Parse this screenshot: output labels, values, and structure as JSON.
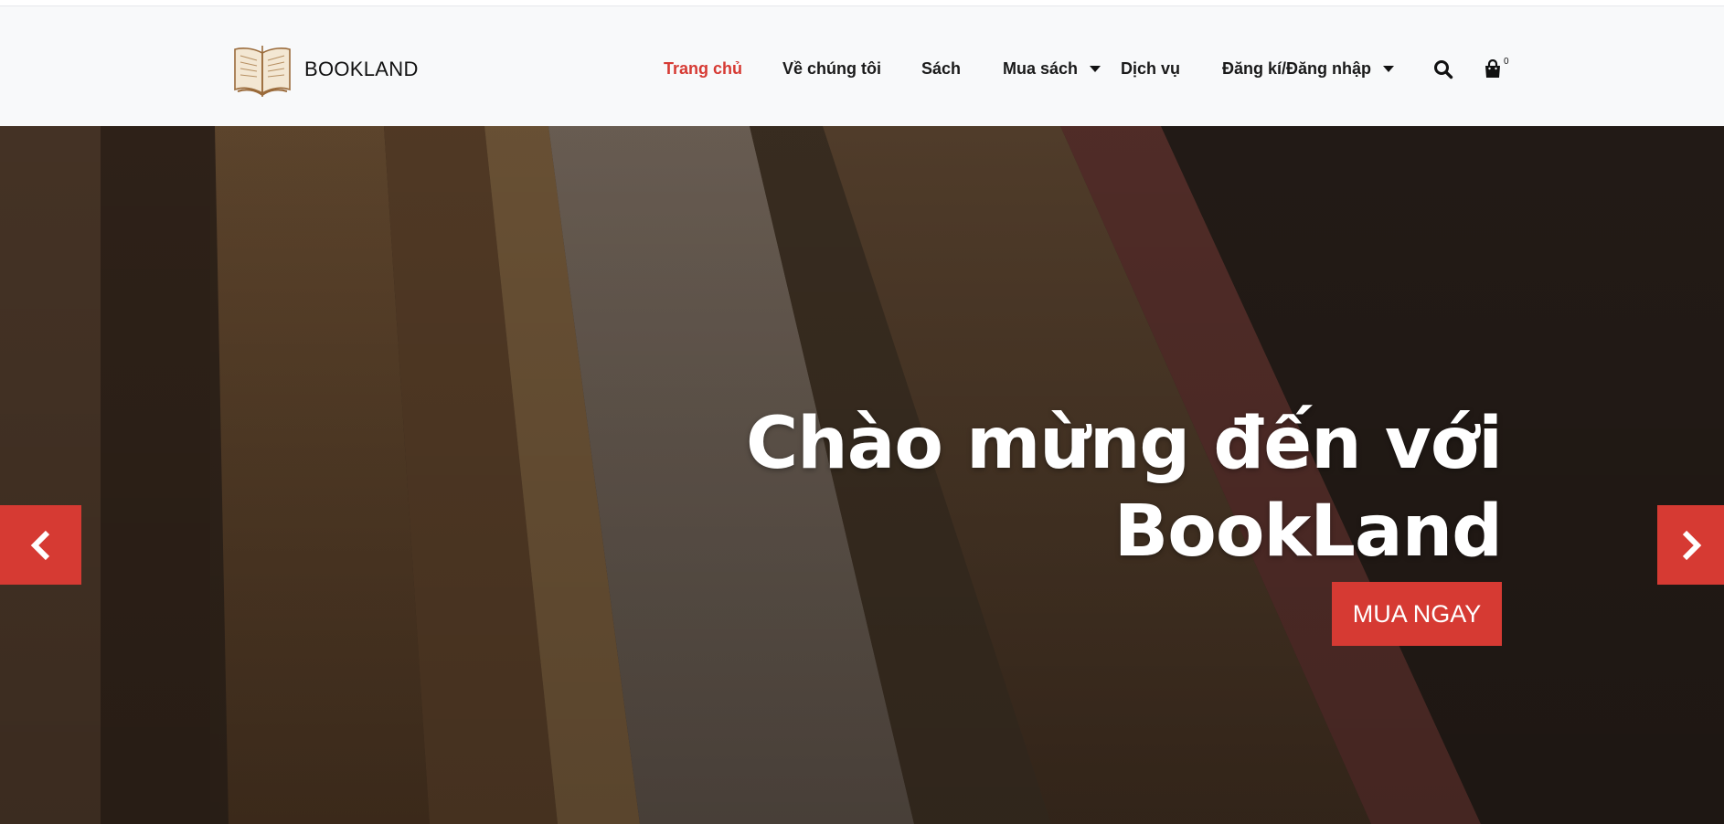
{
  "brand": {
    "name": "BOOKLAND"
  },
  "nav": {
    "items": [
      {
        "label": "Trang chủ",
        "active": true
      },
      {
        "label": "Về chúng tôi"
      },
      {
        "label": "Sách"
      },
      {
        "label": "Mua sách",
        "has_dropdown": true
      },
      {
        "label": "Dịch vụ"
      },
      {
        "label": "Đăng kí/Đăng nhập",
        "has_dropdown": true
      }
    ],
    "search_icon": "search-icon",
    "cart_icon": "shopping-bag-icon",
    "cart_count": "0"
  },
  "hero": {
    "title_line1": "Chào mừng đến với",
    "title_line2": "BookLand",
    "cta_label": "MUA NGAY",
    "prev_icon": "chevron-left-icon",
    "next_icon": "chevron-right-icon"
  },
  "colors": {
    "accent": "#d63a33",
    "navbar_bg": "#f8f9fa",
    "text_dark": "#1a1a1a"
  }
}
